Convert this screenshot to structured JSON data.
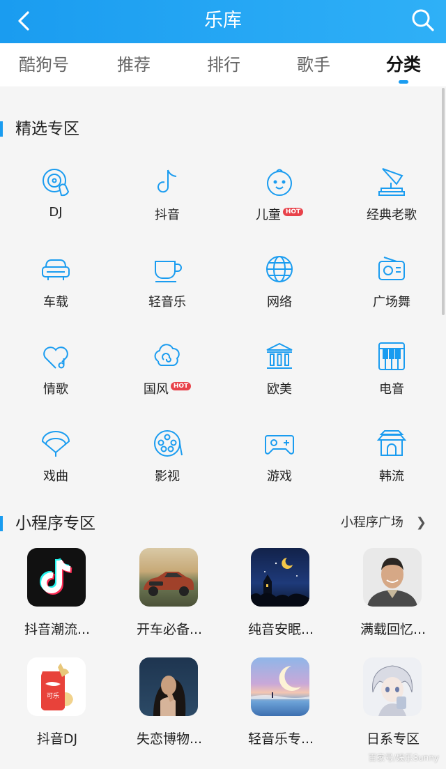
{
  "header": {
    "title": "乐库"
  },
  "tabs": [
    {
      "label": "酷狗号"
    },
    {
      "label": "推荐"
    },
    {
      "label": "排行"
    },
    {
      "label": "歌手"
    },
    {
      "label": "分类"
    }
  ],
  "active_tab": "分类",
  "featured": {
    "title": "精选专区",
    "items": [
      {
        "label": "DJ",
        "icon": "dj-disc-icon"
      },
      {
        "label": "抖音",
        "icon": "music-note-icon"
      },
      {
        "label": "儿童",
        "icon": "baby-face-icon",
        "badge": "HOT"
      },
      {
        "label": "经典老歌",
        "icon": "gramophone-icon"
      },
      {
        "label": "车载",
        "icon": "car-icon"
      },
      {
        "label": "轻音乐",
        "icon": "cup-icon"
      },
      {
        "label": "网络",
        "icon": "globe-icon"
      },
      {
        "label": "广场舞",
        "icon": "radio-icon"
      },
      {
        "label": "情歌",
        "icon": "heart-note-icon"
      },
      {
        "label": "国风",
        "icon": "cloud-icon",
        "badge": "HOT"
      },
      {
        "label": "欧美",
        "icon": "temple-icon"
      },
      {
        "label": "电音",
        "icon": "piano-keys-icon"
      },
      {
        "label": "戏曲",
        "icon": "fan-icon"
      },
      {
        "label": "影视",
        "icon": "film-reel-icon"
      },
      {
        "label": "游戏",
        "icon": "gamepad-icon"
      },
      {
        "label": "韩流",
        "icon": "palace-icon"
      }
    ]
  },
  "mini_programs": {
    "title": "小程序专区",
    "more_label": "小程序广场",
    "items": [
      {
        "label": "抖音潮流...",
        "thumb": "tiktok-logo"
      },
      {
        "label": "开车必备...",
        "thumb": "sports-car"
      },
      {
        "label": "纯音安眠...",
        "thumb": "night-moon"
      },
      {
        "label": "满载回忆...",
        "thumb": "singer-portrait"
      },
      {
        "label": "抖音DJ",
        "thumb": "cola-can-cat"
      },
      {
        "label": "失恋博物...",
        "thumb": "girl-portrait"
      },
      {
        "label": "轻音乐专...",
        "thumb": "moon-sea"
      },
      {
        "label": "日系专区",
        "thumb": "anime-character"
      }
    ]
  },
  "watermark": "百家号/娱乐Sunny",
  "colors": {
    "accent": "#1a9cf0",
    "hot_badge": "#e8424a"
  }
}
